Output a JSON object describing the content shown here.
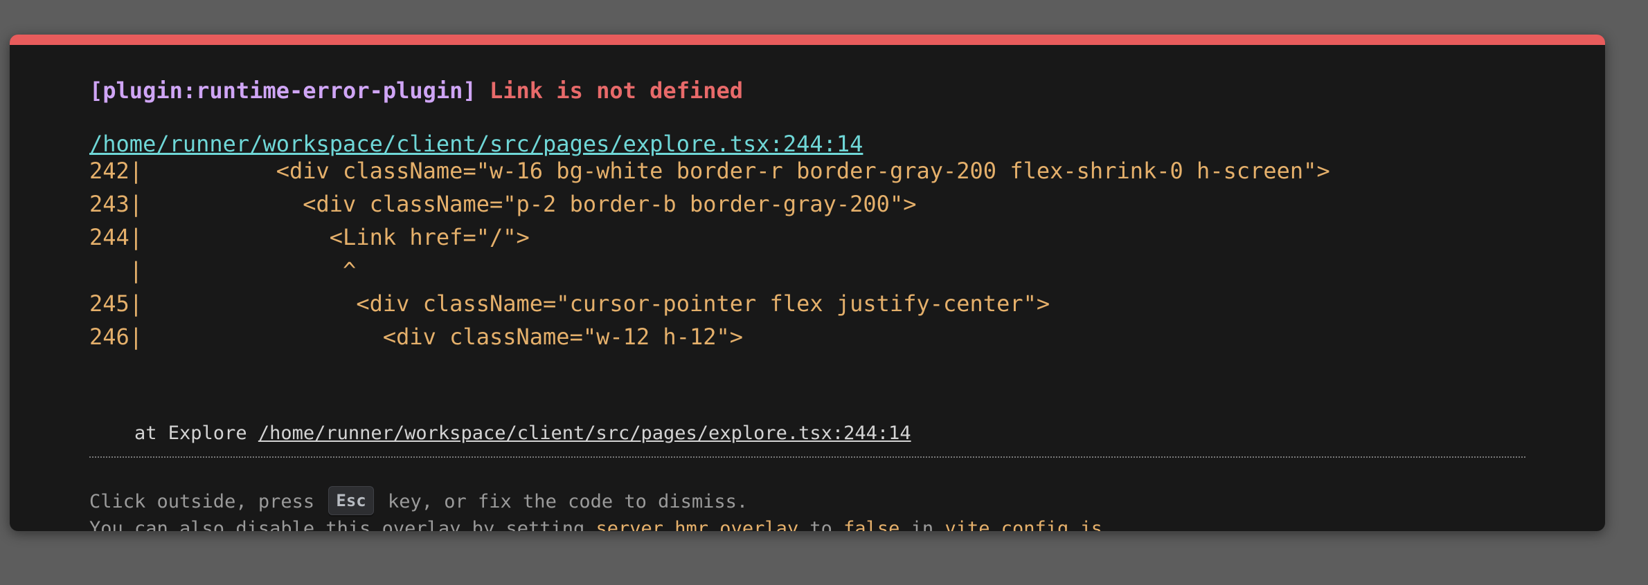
{
  "overlay": {
    "accent_color": "#e85c5c",
    "plugin_tag": "[plugin:runtime-error-plugin]",
    "message": "Link is not defined",
    "file_link": "/home/runner/workspace/client/src/pages/explore.tsx:244:14",
    "frame_lines": [
      "242|          <div className=\"w-16 bg-white border-r border-gray-200 flex-shrink-0 h-screen\">",
      "243|            <div className=\"p-2 border-b border-gray-200\">",
      "244|              <Link href=\"/\">",
      "   |               ^",
      "245|                <div className=\"cursor-pointer flex justify-center\">",
      "246|                  <div className=\"w-12 h-12\">"
    ],
    "stack_prefix": "    at Explore ",
    "stack_link": "/home/runner/workspace/client/src/pages/explore.tsx:244:14",
    "tip1_before": "Click outside, press ",
    "tip1_key": "Esc",
    "tip1_after": " key, or fix the code to dismiss.",
    "tip2_prefix": "You can also disable this overlay by setting ",
    "tip2_setting": "server.hmr.overlay",
    "tip2_to": " to ",
    "tip2_value": "false",
    "tip2_in": " in ",
    "tip2_file": "vite.config.js",
    "tip2_end": "."
  }
}
